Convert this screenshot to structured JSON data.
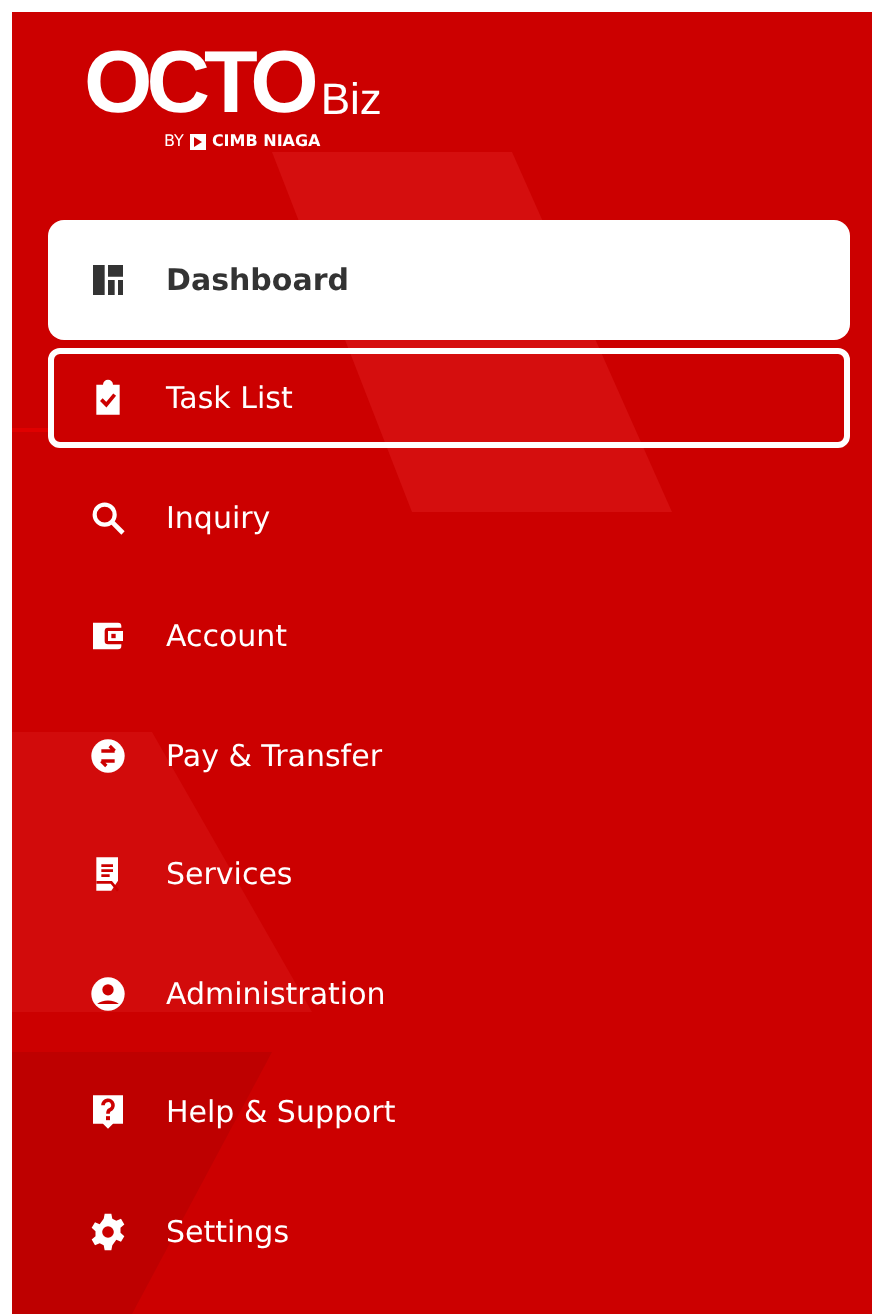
{
  "logo": {
    "wordmark": "OCTO",
    "product": "Biz",
    "byline": "BY",
    "bank": "CIMB NIAGA"
  },
  "menu": [
    {
      "label": "Dashboard",
      "selected": true,
      "highlighted": false
    },
    {
      "label": "Task List",
      "selected": false,
      "highlighted": true
    },
    {
      "label": "Inquiry",
      "selected": false,
      "highlighted": false
    },
    {
      "label": "Account",
      "selected": false,
      "highlighted": false
    },
    {
      "label": "Pay & Transfer",
      "selected": false,
      "highlighted": false
    },
    {
      "label": "Services",
      "selected": false,
      "highlighted": false
    },
    {
      "label": "Administration",
      "selected": false,
      "highlighted": false
    },
    {
      "label": "Help & Support",
      "selected": false,
      "highlighted": false
    },
    {
      "label": "Settings",
      "selected": false,
      "highlighted": false
    }
  ]
}
